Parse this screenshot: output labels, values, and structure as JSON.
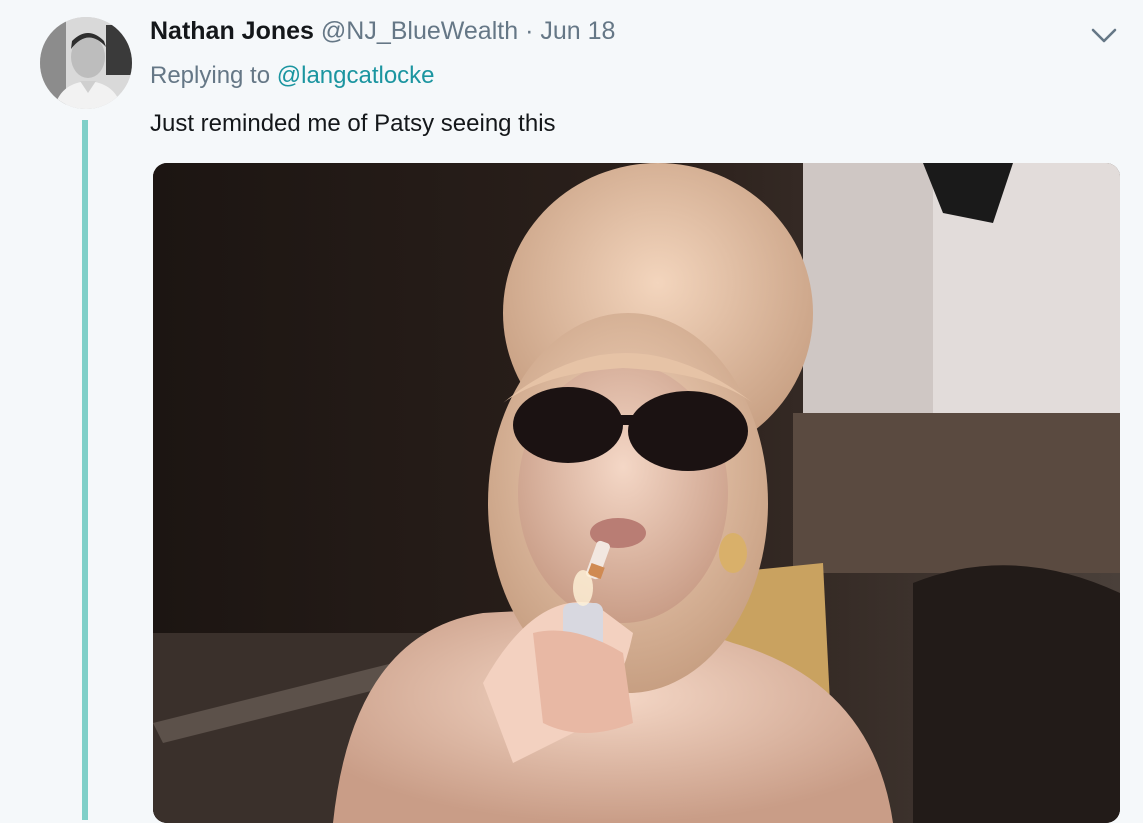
{
  "tweet": {
    "name": "Nathan Jones",
    "handle": "@NJ_BlueWealth",
    "separator": "·",
    "date": "Jun 18",
    "reply_prefix": "Replying to",
    "reply_to": "@langcatlocke",
    "text": "Just reminded me of Patsy seeing this"
  },
  "icons": {
    "menu": "chevron-down-icon"
  },
  "colors": {
    "thread_line": "#7fcfc8",
    "link": "#1b95a0",
    "muted": "#657786",
    "background": "#f5f8fa"
  }
}
